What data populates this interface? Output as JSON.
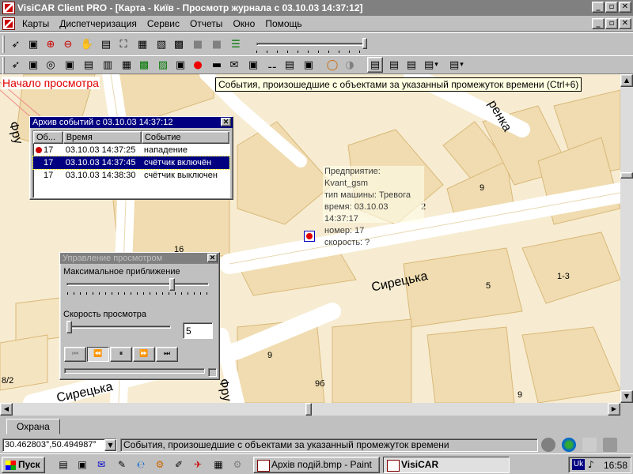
{
  "window": {
    "title": "VisiCAR Client PRO - [Карта - Київ - Просмотр журнала с 03.10.03 14:37:12]",
    "min": "_",
    "max": "▫",
    "close": "✕"
  },
  "menu": {
    "items": [
      "Карты",
      "Диспетчеризация",
      "Сервис",
      "Отчеты",
      "Окно",
      "Помощь"
    ],
    "min": "_",
    "max": "▫",
    "close": "✕"
  },
  "toolbar1": {
    "icons": [
      "pointer-icon",
      "select-icon",
      "zoom-in-icon",
      "zoom-out-icon",
      "hand-icon",
      "map-icon",
      "binoculars-icon",
      "grid-icon",
      "layers-icon",
      "print-icon",
      "gray-square-icon",
      "gray-square2-icon",
      "stack-icon"
    ],
    "glyphs": [
      "➶",
      "▣",
      "⊕",
      "⊖",
      "✋",
      "▤",
      "⛶",
      "▦",
      "▧",
      "▩",
      "■",
      "■",
      "☰"
    ]
  },
  "toolbar2": {
    "glyphs": [
      "➶",
      "▣",
      "◎",
      "▣",
      "▤",
      "▥",
      "▦",
      "▩",
      "▨",
      "▣",
      "●",
      "▬",
      "✉",
      "▣",
      "⚋",
      "▤",
      "▣",
      "◯",
      "◑",
      "▤",
      "▤",
      "▤",
      "▤"
    ]
  },
  "map": {
    "start_label": "Начало просмотра",
    "tooltip": "События, произошедшие с объектами за указанный промежуток времени (Ctrl+6)",
    "streets": [
      "Сирецька",
      "Сирецька",
      "Фру",
      "Фру",
      "ренка"
    ],
    "house_numbers": [
      "9",
      "5",
      "1-3",
      "9",
      "9б",
      "9",
      "8/2",
      "16",
      "2"
    ],
    "info": {
      "enterprise": "Предприятие: Kvant_gsm",
      "car_type": "тип машины: Тревога",
      "time": "время: 03.10.03 14:37:17",
      "number": "номер: 17",
      "speed": "скорость: ?"
    }
  },
  "archive": {
    "title": "Архив событий с 03.10.03 14:37:12",
    "close": "✕",
    "columns": [
      "Об...",
      "Время",
      "Событие"
    ],
    "rows": [
      {
        "obj": "17",
        "time": "03.10.03 14:37:25",
        "event": "нападение",
        "alarm": true
      },
      {
        "obj": "17",
        "time": "03.10.03 14:37:45",
        "event": "счётчик включён",
        "selected": true
      },
      {
        "obj": "17",
        "time": "03.10.03 14:38:30",
        "event": "счётчик выключен"
      }
    ]
  },
  "playback": {
    "title": "Управление просмотром",
    "close": "✕",
    "zoom_label": "Максимальное приближение",
    "zoom_level": 0.75,
    "speed_label": "Скорость просмотра",
    "speed_value": "5",
    "buttons": [
      "⏮",
      "⏪",
      "⏸",
      "⏩",
      "⏭"
    ]
  },
  "status": {
    "tab": "Охрана",
    "coords": "30.462803°,50.494987°",
    "text": "События, произошедшие с объектами за указанный промежуток времени"
  },
  "taskbar": {
    "start": "Пуск",
    "tasks": [
      "Архів подій.bmp - Paint",
      "VisiCAR"
    ],
    "lang": "Uk",
    "clock": "16:58"
  }
}
